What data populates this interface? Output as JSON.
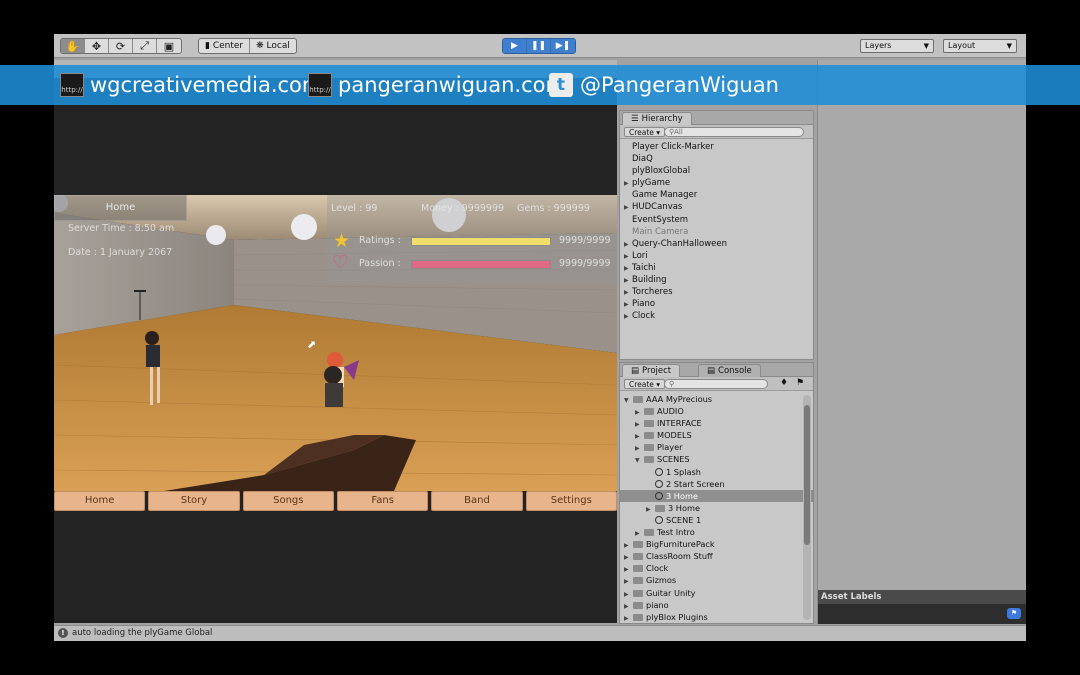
{
  "toolbar": {
    "pivot_center": "Center",
    "pivot_local": "Local",
    "layers_label": "Layers",
    "layout_label": "Layout"
  },
  "game_hud": {
    "location": "Home",
    "server_time": "Server Time : 8:50 am",
    "date": "Date : 1 January 2067",
    "level": "Level : 99",
    "money": "Money : 9999999",
    "gems": "Gems : 999999",
    "ratings_label": "Ratings :",
    "ratings_value": "9999/9999",
    "ratings_fraction": 1.0,
    "passion_label": "Passion :",
    "passion_value": "9999/9999",
    "passion_fraction": 1.0,
    "menu": [
      "Home",
      "Story",
      "Songs",
      "Fans",
      "Band",
      "Settings"
    ]
  },
  "hierarchy": {
    "tab": "Hierarchy",
    "create": "Create",
    "search_placeholder": "All",
    "items": [
      {
        "label": "Player Click-Marker",
        "expandable": false
      },
      {
        "label": "DiaQ",
        "expandable": false
      },
      {
        "label": "plyBloxGlobal",
        "expandable": false
      },
      {
        "label": "plyGame",
        "expandable": true
      },
      {
        "label": "Game Manager",
        "expandable": false
      },
      {
        "label": "HUDCanvas",
        "expandable": true
      },
      {
        "label": "EventSystem",
        "expandable": false
      },
      {
        "label": "Main Camera",
        "expandable": false,
        "dim": true
      },
      {
        "label": "Query-ChanHalloween",
        "expandable": true
      },
      {
        "label": "Lori",
        "expandable": true
      },
      {
        "label": "Taichi",
        "expandable": true
      },
      {
        "label": "Building",
        "expandable": true
      },
      {
        "label": "Torcheres",
        "expandable": true
      },
      {
        "label": "Piano",
        "expandable": true
      },
      {
        "label": "Clock",
        "expandable": true
      }
    ]
  },
  "project": {
    "tab": "Project",
    "console_tab": "Console",
    "create": "Create",
    "items": [
      {
        "label": "AAA MyPrecious",
        "depth": 0,
        "kind": "folder",
        "open": true
      },
      {
        "label": "AUDIO",
        "depth": 1,
        "kind": "folder"
      },
      {
        "label": "INTERFACE",
        "depth": 1,
        "kind": "folder"
      },
      {
        "label": "MODELS",
        "depth": 1,
        "kind": "folder"
      },
      {
        "label": "Player",
        "depth": 1,
        "kind": "folder"
      },
      {
        "label": "SCENES",
        "depth": 1,
        "kind": "folder",
        "open": true
      },
      {
        "label": "1 Splash",
        "depth": 2,
        "kind": "scene"
      },
      {
        "label": "2 Start Screen",
        "depth": 2,
        "kind": "scene"
      },
      {
        "label": "3 Home",
        "depth": 2,
        "kind": "scene",
        "selected": true
      },
      {
        "label": "3 Home",
        "depth": 2,
        "kind": "folder"
      },
      {
        "label": "SCENE 1",
        "depth": 2,
        "kind": "scene"
      },
      {
        "label": "Test Intro",
        "depth": 1,
        "kind": "folder"
      },
      {
        "label": "BigFurniturePack",
        "depth": 0,
        "kind": "folder"
      },
      {
        "label": "ClassRoom Stuff",
        "depth": 0,
        "kind": "folder"
      },
      {
        "label": "Clock",
        "depth": 0,
        "kind": "folder"
      },
      {
        "label": "Gizmos",
        "depth": 0,
        "kind": "folder"
      },
      {
        "label": "Guitar Unity",
        "depth": 0,
        "kind": "folder"
      },
      {
        "label": "piano",
        "depth": 0,
        "kind": "folder"
      },
      {
        "label": "plyBlox Plugins",
        "depth": 0,
        "kind": "folder"
      }
    ]
  },
  "inspector": {
    "asset_labels": "Asset Labels"
  },
  "status": {
    "message": "auto loading the plyGame Global"
  },
  "banner": {
    "site1": "wgcreativemedia.com",
    "site2": "pangeranwiguan.com",
    "twitter": "@PangeranWiguan",
    "http_label": "http://"
  },
  "colors": {
    "banner": "#1e8cd7",
    "ratings_bar": "#f1dd6a",
    "passion_bar": "#e06a86",
    "menu_button": "#e7b48b"
  }
}
